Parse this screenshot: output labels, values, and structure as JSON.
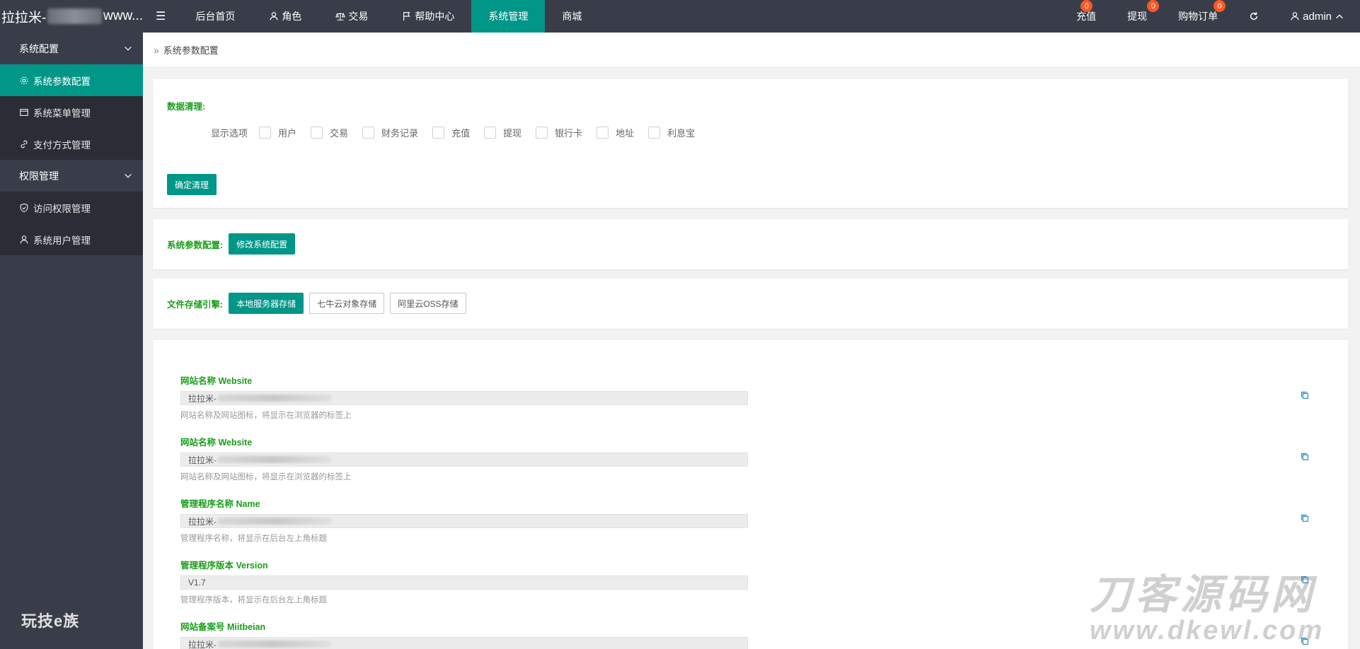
{
  "brand": {
    "prefix": "拉拉米-",
    "suffix": "www..."
  },
  "topnav": {
    "items": [
      {
        "label": "后台首页",
        "icon": ""
      },
      {
        "label": "角色",
        "icon": "user-icon"
      },
      {
        "label": "交易",
        "icon": "scale-icon"
      },
      {
        "label": "帮助中心",
        "icon": "flag-icon"
      },
      {
        "label": "系统管理",
        "icon": ""
      },
      {
        "label": "商城",
        "icon": ""
      }
    ],
    "right": {
      "recharge": {
        "label": "充值",
        "badge": "0"
      },
      "withdraw": {
        "label": "提现",
        "badge": "0"
      },
      "orders": {
        "label": "购物订单",
        "badge": "0"
      },
      "user": "admin"
    }
  },
  "sidebar": {
    "groups": [
      {
        "label": "系统配置",
        "items": [
          {
            "label": "系统参数配置",
            "icon": "gear-icon"
          },
          {
            "label": "系统菜单管理",
            "icon": "window-icon"
          },
          {
            "label": "支付方式管理",
            "icon": "link-icon"
          }
        ]
      },
      {
        "label": "权限管理",
        "items": [
          {
            "label": "访问权限管理",
            "icon": "shield-check-icon"
          },
          {
            "label": "系统用户管理",
            "icon": "user-icon"
          }
        ]
      }
    ],
    "logo": "玩技e族"
  },
  "breadcrumb": {
    "current": "系统参数配置"
  },
  "data_clean": {
    "title": "数据清理:",
    "options_label": "显示选项",
    "options": [
      "用户",
      "交易",
      "财务记录",
      "充值",
      "提现",
      "银行卡",
      "地址",
      "利息宝"
    ],
    "confirm": "确定清理"
  },
  "sys_config": {
    "label": "系统参数配置:",
    "button": "修改系统配置"
  },
  "storage": {
    "label": "文件存储引擎:",
    "options": [
      "本地服务器存储",
      "七牛云对象存储",
      "阿里云OSS存储"
    ]
  },
  "fields": [
    {
      "label": "网站名称 Website",
      "value": "拉拉米-",
      "hint": "网站名称及网站图标，将显示在浏览器的标签上"
    },
    {
      "label": "网站名称 Website",
      "value": "拉拉米-",
      "hint": "网站名称及网站图标，将显示在浏览器的标签上"
    },
    {
      "label": "管理程序名称 Name",
      "value": "拉拉米-",
      "hint": "管理程序名称，将显示在后台左上角标题"
    },
    {
      "label": "管理程序版本 Version",
      "value": "V1.7",
      "hint": "管理程序版本，将显示在后台左上角标题"
    },
    {
      "label": "网站备案号 Miitbeian",
      "value": "拉拉米-",
      "hint": ""
    }
  ],
  "watermark": {
    "top": "刀客源码网",
    "bottom": "www.dkewl.com"
  },
  "colors": {
    "accent": "#009688",
    "topbar": "#393d49",
    "sidebar_item": "#2a2d36",
    "badge": "#ff5722",
    "label_green": "#1a9e1a"
  }
}
